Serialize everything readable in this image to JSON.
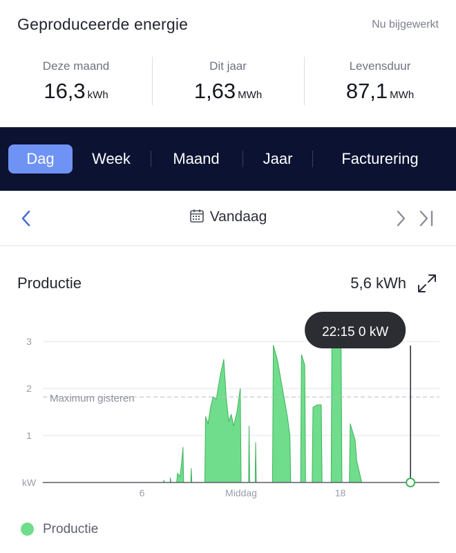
{
  "header": {
    "title": "Geproduceerde energie",
    "status": "Nu bijgewerkt",
    "stats": [
      {
        "label": "Deze maand",
        "value": "16,3",
        "unit": "kWh"
      },
      {
        "label": "Dit jaar",
        "value": "1,63",
        "unit": "MWh"
      },
      {
        "label": "Levensduur",
        "value": "87,1",
        "unit": "MWh"
      }
    ]
  },
  "tabs": [
    {
      "label": "Dag",
      "active": true
    },
    {
      "label": "Week",
      "active": false
    },
    {
      "label": "Maand",
      "active": false
    },
    {
      "label": "Jaar",
      "active": false
    },
    {
      "label": "Facturering",
      "active": false
    }
  ],
  "date_nav": {
    "label": "Vandaag"
  },
  "section": {
    "title": "Productie",
    "total": "5,6 kWh"
  },
  "icons": {
    "prev": "chevron-left-icon",
    "next": "chevron-right-icon",
    "last": "skip-to-end-icon",
    "calendar": "calendar-icon",
    "expand": "expand-icon"
  },
  "colors": {
    "tabbar_bg": "#0c1232",
    "tab_active": "#6f93f5",
    "accent_blue": "#4a6fd6",
    "fill": "#6fdd8b",
    "stroke": "#3fb35c"
  },
  "chart_data": {
    "type": "area",
    "xlabel": "",
    "ylabel": "kW",
    "xlim": [
      0,
      24
    ],
    "ylim": [
      0,
      3.5
    ],
    "y_ticks": [
      0,
      1,
      2,
      3
    ],
    "y_tick_labels": [
      "kW",
      "1",
      "2",
      "3"
    ],
    "x_ticks": [
      6,
      12,
      18
    ],
    "x_tick_labels": [
      "6",
      "Middag",
      "18"
    ],
    "grid": true,
    "reference_line": {
      "label": "Maximum gisteren",
      "value": 1.82
    },
    "cursor": {
      "time": 22.25,
      "value": 0,
      "tooltip": "22:15 0 kW"
    },
    "legend": [
      {
        "name": "Productie",
        "position": "bottom-left"
      }
    ],
    "series": [
      {
        "name": "Productie",
        "points": [
          [
            0,
            0
          ],
          [
            7.3,
            0
          ],
          [
            7.32,
            0.05
          ],
          [
            7.36,
            0
          ],
          [
            7.7,
            0
          ],
          [
            7.72,
            0.1
          ],
          [
            7.76,
            0
          ],
          [
            8.1,
            0
          ],
          [
            8.15,
            0.2
          ],
          [
            8.3,
            0.12
          ],
          [
            8.4,
            0.42
          ],
          [
            8.48,
            0.75
          ],
          [
            8.52,
            0
          ],
          [
            8.95,
            0
          ],
          [
            8.98,
            0.3
          ],
          [
            9.02,
            0
          ],
          [
            9.8,
            0
          ],
          [
            9.85,
            1.4
          ],
          [
            10.0,
            1.25
          ],
          [
            10.15,
            1.6
          ],
          [
            10.3,
            1.82
          ],
          [
            10.5,
            1.78
          ],
          [
            10.75,
            2.3
          ],
          [
            10.95,
            2.62
          ],
          [
            11.1,
            1.8
          ],
          [
            11.25,
            1.3
          ],
          [
            11.4,
            1.45
          ],
          [
            11.55,
            1.2
          ],
          [
            11.75,
            1.5
          ],
          [
            11.95,
            2.0
          ],
          [
            12.0,
            0
          ],
          [
            12.45,
            0
          ],
          [
            12.48,
            1.2
          ],
          [
            12.52,
            0
          ],
          [
            12.85,
            0
          ],
          [
            12.88,
            0.85
          ],
          [
            12.92,
            0
          ],
          [
            13.9,
            0
          ],
          [
            13.95,
            2.92
          ],
          [
            14.2,
            2.6
          ],
          [
            14.5,
            2.0
          ],
          [
            14.8,
            1.4
          ],
          [
            14.95,
            1.0
          ],
          [
            15.0,
            0
          ],
          [
            15.6,
            0
          ],
          [
            15.65,
            2.72
          ],
          [
            15.85,
            2.5
          ],
          [
            15.9,
            0
          ],
          [
            16.3,
            0
          ],
          [
            16.35,
            1.6
          ],
          [
            16.6,
            1.65
          ],
          [
            16.85,
            1.65
          ],
          [
            16.9,
            0
          ],
          [
            17.45,
            0
          ],
          [
            17.5,
            3.38
          ],
          [
            17.8,
            3.0
          ],
          [
            18.05,
            2.88
          ],
          [
            18.1,
            0
          ],
          [
            18.55,
            0
          ],
          [
            18.6,
            1.25
          ],
          [
            18.9,
            0.9
          ],
          [
            19.0,
            0.45
          ],
          [
            19.3,
            0
          ],
          [
            24,
            0
          ]
        ]
      }
    ]
  }
}
